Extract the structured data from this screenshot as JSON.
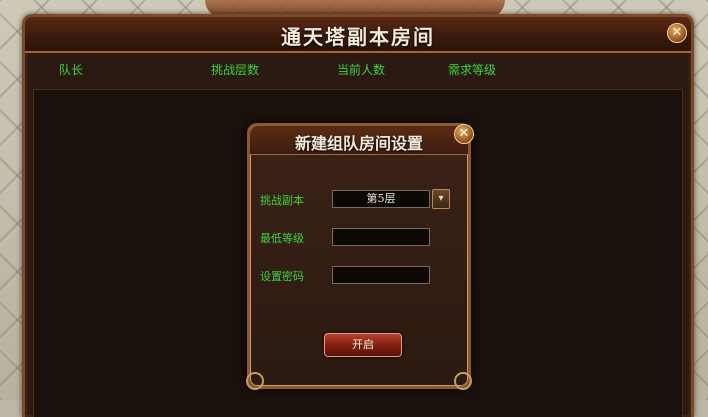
{
  "main_window": {
    "title": "通天塔副本房间",
    "close_label": "✕",
    "columns": [
      "队长",
      "挑战层数",
      "当前人数",
      "需求等级"
    ]
  },
  "dialog": {
    "title": "新建组队房间设置",
    "close_label": "✕",
    "fields": [
      {
        "label": "挑战副本",
        "value": "第5层"
      },
      {
        "label": "最低等级",
        "value": ""
      },
      {
        "label": "设置密码",
        "value": ""
      }
    ],
    "dropdown_icon": "▾",
    "start_label": "开启"
  },
  "colors": {
    "label_green": "#3ed23a",
    "frame_bronze": "#8a5a2e",
    "button_red": "#7a1a0e"
  },
  "icons": [
    "close-icon",
    "chevron-down-icon"
  ]
}
